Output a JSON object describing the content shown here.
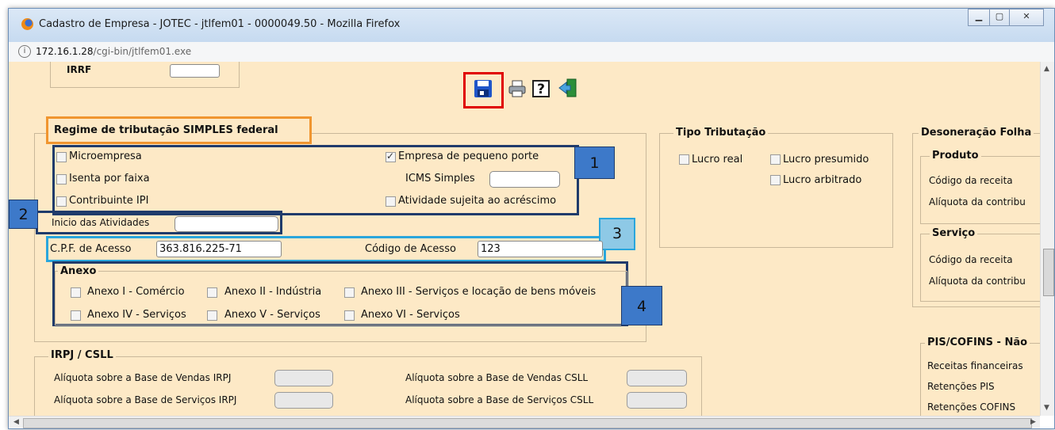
{
  "window": {
    "title": "Cadastro de Empresa - JOTEC - jtlfem01 - 0000049.50 - Mozilla Firefox"
  },
  "address": {
    "host": "172.16.1.28",
    "path": "/cgi-bin/jtlfem01.exe"
  },
  "irrf": {
    "label": "IRRF"
  },
  "simples": {
    "legend": "Regime de tributação SIMPLES federal",
    "microempresa": "Microempresa",
    "empresa_pequeno_porte": "Empresa de pequeno porte",
    "isenta_faixa": "Isenta por faixa",
    "icms_simples": "ICMS Simples",
    "contribuinte_ipi": "Contribuinte IPI",
    "atividade_sujeita": "Atividade sujeita ao acréscimo",
    "inicio_atividades": "Inicio das Atividades",
    "cpf_label": "C.P.F. de Acesso",
    "cpf_value": "363.816.225-71",
    "codigo_label": "Código de Acesso",
    "codigo_value": "123"
  },
  "anexo": {
    "legend": "Anexo",
    "items": [
      "Anexo I - Comércio",
      "Anexo II - Indústria",
      "Anexo III - Serviços e locação de bens móveis",
      "Anexo IV - Serviços",
      "Anexo V - Serviços",
      "Anexo VI - Serviços"
    ]
  },
  "badges": {
    "b1": "1",
    "b2": "2",
    "b3": "3",
    "b4": "4"
  },
  "tipo": {
    "legend": "Tipo Tributação",
    "lucro_real": "Lucro real",
    "lucro_presumido": "Lucro presumido",
    "lucro_arbitrado": "Lucro arbitrado"
  },
  "desoneracao": {
    "legend": "Desoneração Folha",
    "produto": "Produto",
    "servico": "Serviço",
    "codigo_receita": "Código da receita",
    "aliquota": "Alíquota da contribu"
  },
  "pis": {
    "legend": "PIS/COFINS - Não",
    "receitas": "Receitas financeiras",
    "ret_pis": "Retenções PIS",
    "ret_cofins": "Retenções COFINS"
  },
  "irpj": {
    "legend": "IRPJ / CSLL",
    "vendas_irpj": "Alíquota sobre a Base de Vendas IRPJ",
    "servicos_irpj": "Alíquota sobre a Base de Serviços IRPJ",
    "vendas_csll": "Alíquota sobre a Base de Vendas CSLL",
    "servicos_csll": "Alíquota sobre a Base de Serviços CSLL"
  },
  "colors": {
    "highlight_orange": "#f0952f",
    "highlight_navy": "#1f3b6b",
    "highlight_cyan": "#2aa6dc",
    "highlight_red": "#e00000",
    "badge_fill": "#3d79c9",
    "badge_fill_light": "#8ec9e6"
  },
  "icons": [
    "save-icon",
    "print-icon",
    "help-icon",
    "exit-icon"
  ]
}
